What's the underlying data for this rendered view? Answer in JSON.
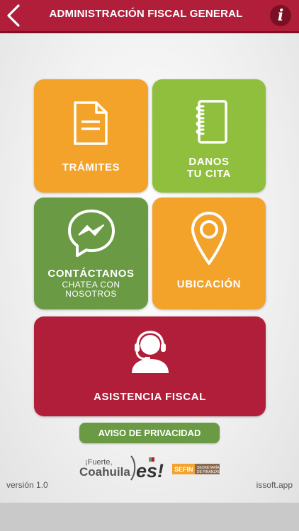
{
  "header": {
    "title": "ADMINISTRACIÓN FISCAL GENERAL",
    "back_icon": "chevron-left-icon",
    "info_label": "i",
    "color": "#b01e3a"
  },
  "tiles": {
    "tramites": {
      "label": "TRÁMITES",
      "icon": "document-icon",
      "color": "#f3a22a"
    },
    "cita": {
      "label_line1": "DANOS",
      "label_line2": "TU CITA",
      "icon": "notebook-icon",
      "color": "#8fbf3c"
    },
    "contactanos": {
      "label": "CONTÁCTANOS",
      "sub_line1": "CHATEA CON",
      "sub_line2": "NOSOTROS",
      "icon": "messenger-icon",
      "color": "#6a9a43"
    },
    "ubicacion": {
      "label": "UBICACIÓN",
      "icon": "location-pin-icon",
      "color": "#f3a22a"
    },
    "asistencia": {
      "label": "ASISTENCIA FISCAL",
      "icon": "headset-agent-icon",
      "color": "#b01e3a"
    }
  },
  "privacy": {
    "label": "AVISO DE PRIVACIDAD"
  },
  "logo": {
    "fuerte": "¡Fuerte,",
    "coahuila": "Coahuila",
    "es": "es!",
    "sefin": "SEFIN",
    "secretaria_line1": "SECRETARÍA",
    "secretaria_line2": "DE FINANZAS"
  },
  "footer": {
    "version": "versión 1.0",
    "site": "issoft.app"
  }
}
